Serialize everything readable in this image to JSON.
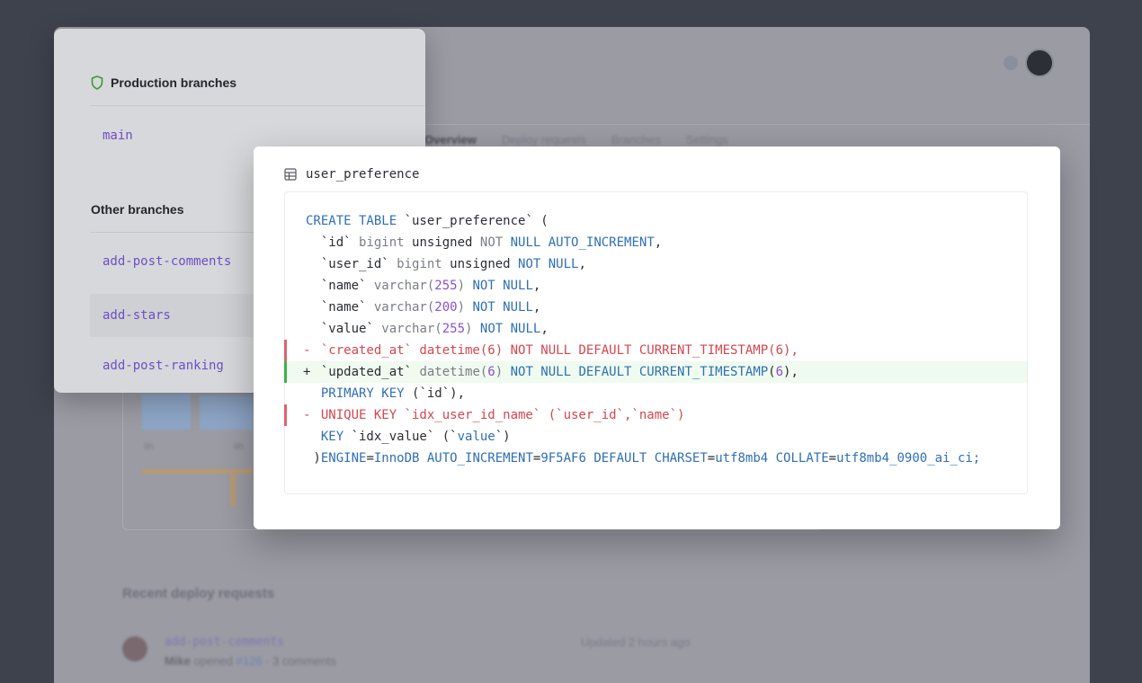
{
  "background": {
    "tabs": [
      "Overview",
      "Deploy requests",
      "Branches",
      "Settings"
    ],
    "section_title": "Recent deploy requests",
    "deploy_request": {
      "branch": "add-post-comments",
      "author": "Mike",
      "action": "opened",
      "pr": "#126",
      "comments": "3 comments",
      "updated": "Updated 2 hours ago"
    },
    "chart_ticks": [
      "9h",
      "8h"
    ]
  },
  "branches": {
    "production_title": "Production branches",
    "production": [
      "main"
    ],
    "other_title": "Other branches",
    "other": [
      "add-post-comments",
      "add-stars",
      "add-post-ranking"
    ]
  },
  "schema": {
    "table_name": "user_preference",
    "lines": [
      {
        "type": "ctx",
        "segments": [
          {
            "c": "kw",
            "t": "CREATE TABLE "
          },
          {
            "c": "tx",
            "t": "`user_preference` ("
          }
        ]
      },
      {
        "type": "ctx",
        "segments": [
          {
            "c": "tx",
            "t": "  `id` "
          },
          {
            "c": "ty",
            "t": "bigint "
          },
          {
            "c": "tx",
            "t": "unsigned "
          },
          {
            "c": "ty",
            "t": "NOT "
          },
          {
            "c": "kw",
            "t": "NULL AUTO_INCREMENT"
          },
          {
            "c": "tx",
            "t": ","
          }
        ]
      },
      {
        "type": "ctx",
        "segments": [
          {
            "c": "tx",
            "t": "  `user_id` "
          },
          {
            "c": "ty",
            "t": "bigint "
          },
          {
            "c": "tx",
            "t": "unsigned "
          },
          {
            "c": "kw",
            "t": "NOT NULL"
          },
          {
            "c": "tx",
            "t": ","
          }
        ]
      },
      {
        "type": "ctx",
        "segments": [
          {
            "c": "tx",
            "t": "  `name` "
          },
          {
            "c": "ty",
            "t": "varchar("
          },
          {
            "c": "num",
            "t": "255"
          },
          {
            "c": "ty",
            "t": ") "
          },
          {
            "c": "kw",
            "t": "NOT NULL"
          },
          {
            "c": "tx",
            "t": ","
          }
        ]
      },
      {
        "type": "ctx",
        "segments": [
          {
            "c": "tx",
            "t": "  `name` "
          },
          {
            "c": "ty",
            "t": "varchar("
          },
          {
            "c": "num",
            "t": "200"
          },
          {
            "c": "ty",
            "t": ") "
          },
          {
            "c": "kw",
            "t": "NOT NULL"
          },
          {
            "c": "tx",
            "t": ","
          }
        ]
      },
      {
        "type": "ctx",
        "segments": [
          {
            "c": "tx",
            "t": "  `value` "
          },
          {
            "c": "ty",
            "t": "varchar("
          },
          {
            "c": "num",
            "t": "255"
          },
          {
            "c": "ty",
            "t": ") "
          },
          {
            "c": "kw",
            "t": "NOT NULL"
          },
          {
            "c": "tx",
            "t": ","
          }
        ]
      },
      {
        "type": "del",
        "segments": [
          {
            "c": "tx",
            "t": "  `created_at` datetime(6) NOT NULL DEFAULT CURRENT_TIMESTAMP(6),"
          }
        ]
      },
      {
        "type": "add",
        "segments": [
          {
            "c": "tx",
            "t": "  `updated_at` "
          },
          {
            "c": "ty",
            "t": "datetime("
          },
          {
            "c": "num",
            "t": "6"
          },
          {
            "c": "ty",
            "t": ") "
          },
          {
            "c": "kw",
            "t": "NOT NULL DEFAULT CURRENT_TIMESTAMP"
          },
          {
            "c": "tx",
            "t": "("
          },
          {
            "c": "num",
            "t": "6"
          },
          {
            "c": "tx",
            "t": "),"
          }
        ]
      },
      {
        "type": "ctx",
        "segments": [
          {
            "c": "kw",
            "t": "  PRIMARY KEY "
          },
          {
            "c": "tx",
            "t": "(`id`),"
          }
        ]
      },
      {
        "type": "del",
        "segments": [
          {
            "c": "tx",
            "t": "  UNIQUE KEY `idx_user_id_name` (`user_id`,`name`)"
          }
        ]
      },
      {
        "type": "ctx",
        "segments": [
          {
            "c": "kw",
            "t": "  KEY "
          },
          {
            "c": "tx",
            "t": "`idx_value` (`"
          },
          {
            "c": "kw",
            "t": "value"
          },
          {
            "c": "tx",
            "t": "`)"
          }
        ]
      },
      {
        "type": "ctx",
        "segments": [
          {
            "c": "tx",
            "t": " )"
          },
          {
            "c": "kw",
            "t": "ENGINE"
          },
          {
            "c": "tx",
            "t": "="
          },
          {
            "c": "kw",
            "t": "InnoDB AUTO_INCREMENT"
          },
          {
            "c": "tx",
            "t": "="
          },
          {
            "c": "kw",
            "t": "9F5AF6 DEFAULT CHARSET"
          },
          {
            "c": "tx",
            "t": "="
          },
          {
            "c": "kw",
            "t": "utf8mb4 COLLATE"
          },
          {
            "c": "tx",
            "t": "="
          },
          {
            "c": "kw",
            "t": "utf8mb4_0900_ai_ci;"
          }
        ]
      }
    ]
  },
  "colors": {
    "accent": "#6f4fc4",
    "deleted": "#d4464f",
    "added": "#3fb14b",
    "keyword": "#2f6fb4"
  },
  "icons": {
    "production": "shield-icon",
    "table": "table-icon"
  }
}
